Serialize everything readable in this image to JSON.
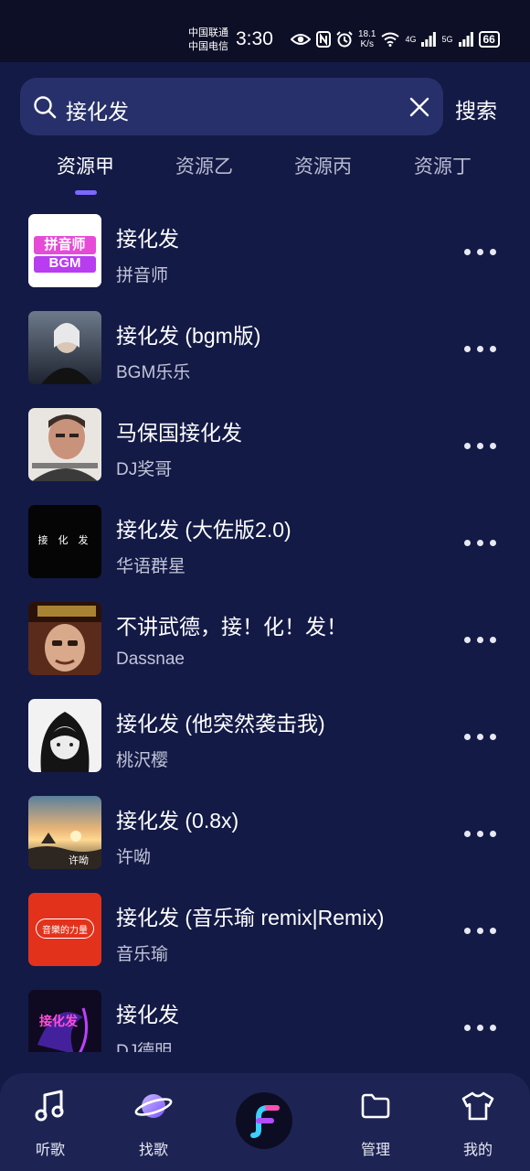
{
  "status_bar": {
    "carrier_1": "中国联通",
    "carrier_2": "中国电信",
    "time": "3:30",
    "speed_value": "18.1",
    "speed_unit": "K/s",
    "network_1": "4G",
    "network_2": "5G",
    "battery": "66"
  },
  "search": {
    "query": "接化发",
    "button_label": "搜索"
  },
  "source_tabs": [
    {
      "label": "资源甲",
      "active": true
    },
    {
      "label": "资源乙",
      "active": false
    },
    {
      "label": "资源丙",
      "active": false
    },
    {
      "label": "资源丁",
      "active": false
    }
  ],
  "results": [
    {
      "title": "接化发",
      "artist": "拼音师",
      "cover_text": "拼音师 BGM"
    },
    {
      "title": "接化发 (bgm版)",
      "artist": "BGM乐乐"
    },
    {
      "title": "马保国接化发",
      "artist": "DJ奖哥"
    },
    {
      "title": "接化发 (大佐版2.0)",
      "artist": "华语群星",
      "cover_text": "接 化 发"
    },
    {
      "title": "不讲武德，接！化！发！",
      "artist": "Dassnae"
    },
    {
      "title": "接化发 (他突然袭击我)",
      "artist": "桃沢樱"
    },
    {
      "title": "接化发 (0.8x)",
      "artist": "许呦",
      "cover_text": "许呦"
    },
    {
      "title": "接化发 (音乐瑜 remix|Remix)",
      "artist": "音乐瑜",
      "cover_text": "音樂的力量"
    },
    {
      "title": "接化发",
      "artist": "DJ德明",
      "cover_text": "接化发"
    }
  ],
  "bottom_nav": [
    {
      "label": "听歌",
      "icon": "music-note-icon"
    },
    {
      "label": "找歌",
      "icon": "planet-icon"
    },
    {
      "label": "",
      "icon": "app-logo-icon"
    },
    {
      "label": "管理",
      "icon": "folder-icon"
    },
    {
      "label": "我的",
      "icon": "shirt-icon"
    }
  ],
  "colors": {
    "background": "#131a46",
    "search_box": "#27306a",
    "accent": "#7d67ff",
    "tabbar": "#1d2454"
  }
}
